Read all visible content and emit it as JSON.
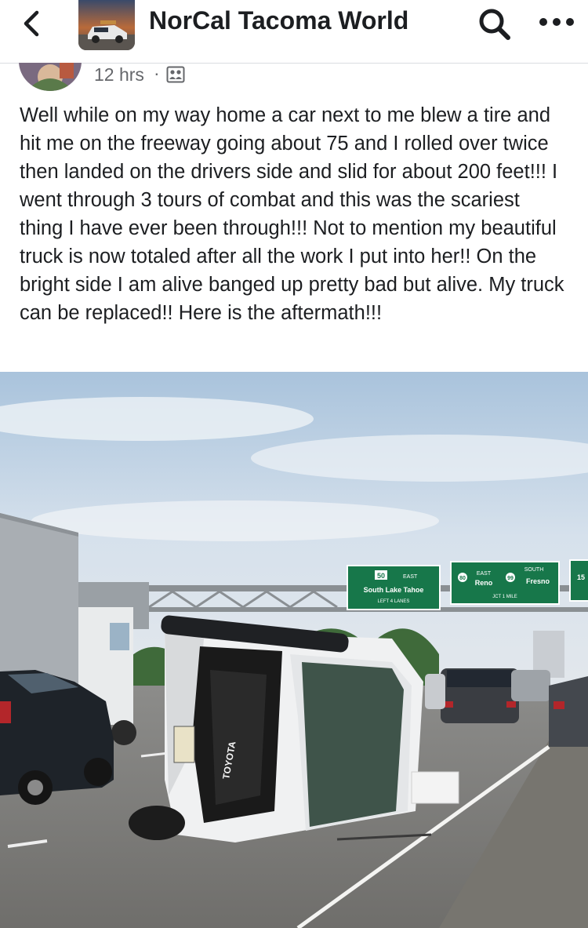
{
  "header": {
    "group_name": "NorCal Tacoma World",
    "back_icon": "chevron-left-icon",
    "search_icon": "search-icon",
    "more_icon": "more-horizontal-icon"
  },
  "post": {
    "timestamp": "12 hrs",
    "separator": "·",
    "audience_icon": "group-members-icon",
    "text": "Well while on my way home a car next to me blew a tire and hit me on the freeway going about 75 and I rolled over twice then landed on the drivers side and slid for about 200 feet!!! I went through 3 tours of combat and this was the scariest thing I have ever been through!!! Not to mention my beautiful truck is now totaled after all the work I put into her!! On the bright side I am alive banged up pretty bad but alive. My truck can be replaced!! Here is the aftermath!!!"
  },
  "photo": {
    "sign_left_route": "50",
    "sign_left_direction": "EAST",
    "sign_left_destination": "South Lake Tahoe",
    "sign_left_lanes": "LEFT 4 LANES",
    "sign_mid_route_a": "80",
    "sign_mid_direction_a": "EAST",
    "sign_mid_destination_a": "Reno",
    "sign_mid_route_b": "99",
    "sign_mid_direction_b": "SOUTH",
    "sign_mid_destination_b": "Fresno",
    "sign_mid_distance": "JCT 1 MILE",
    "sign_right_route": "15",
    "truck_grille_text": "TOYOTA"
  }
}
